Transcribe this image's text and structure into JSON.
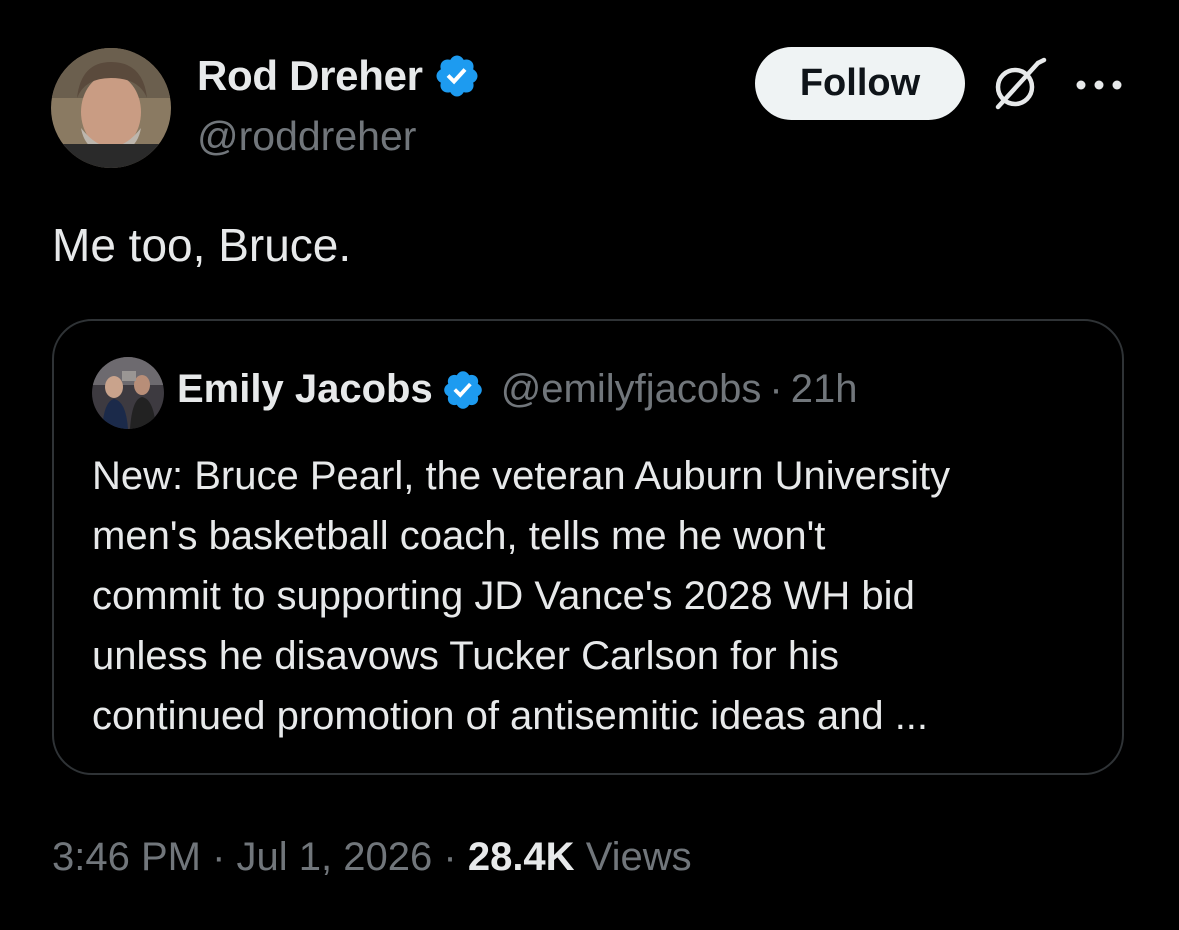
{
  "author": {
    "name": "Rod Dreher",
    "handle": "@roddreher",
    "verified": true
  },
  "actions": {
    "follow_label": "Follow",
    "grok_icon": "grok-icon",
    "more_icon": "more-icon"
  },
  "tweet": {
    "text": "Me too, Bruce."
  },
  "quoted": {
    "name": "Emily Jacobs",
    "handle": "@emilyfjacobs",
    "separator": "·",
    "time": "21h",
    "verified": true,
    "lines": [
      "New: Bruce Pearl, the veteran Auburn University",
      "men's basketball coach, tells me he won't",
      "commit to supporting JD Vance's 2028 WH bid",
      "unless he disavows Tucker Carlson for his",
      "continued promotion of antisemitic ideas and ..."
    ]
  },
  "meta": {
    "time": "3:46 PM",
    "date": "Jul 1, 2026",
    "separator": "·",
    "views_count": "28.4K",
    "views_label": "Views"
  },
  "colors": {
    "background": "#000000",
    "text": "#e7e9ea",
    "muted": "#71767b",
    "verified": "#1d9bf0",
    "border": "#2f3336",
    "follow_bg": "#eff3f4"
  }
}
